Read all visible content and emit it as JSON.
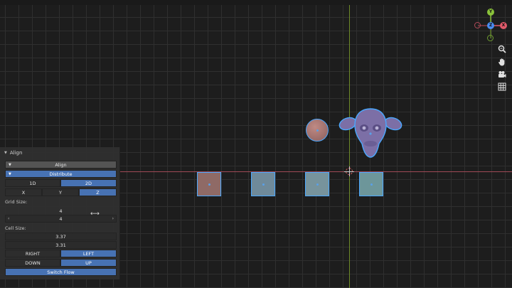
{
  "panel": {
    "title": "Align",
    "align_label": "Align",
    "distribute_label": "Distribute",
    "dimension": [
      "1D",
      "2D"
    ],
    "axes": [
      "X",
      "Y",
      "Z"
    ],
    "grid_size_label": "Grid Size:",
    "grid_size": [
      "4",
      "4"
    ],
    "cell_size_label": "Cell Size:",
    "cell_size": [
      "3.37",
      "3.31"
    ],
    "horizontal": [
      "RIGHT",
      "LEFT"
    ],
    "vertical": [
      "DOWN",
      "UP"
    ],
    "switch_flow_label": "Switch Flow"
  },
  "gizmo": {
    "y": "Y",
    "z": "Z",
    "x": "X"
  },
  "nav_icons": [
    "zoom-icon",
    "hand-pan-icon",
    "camera-icon",
    "grid-icon"
  ],
  "colors": {
    "active_blue": "#4772b3",
    "selection_outline": "#4aa8ff",
    "x_axis": "#a04a56",
    "y_axis": "#6d8a28",
    "gizmo_x": "#e05a6a",
    "gizmo_y": "#8ac23a",
    "gizmo_z": "#4a8cf0"
  }
}
